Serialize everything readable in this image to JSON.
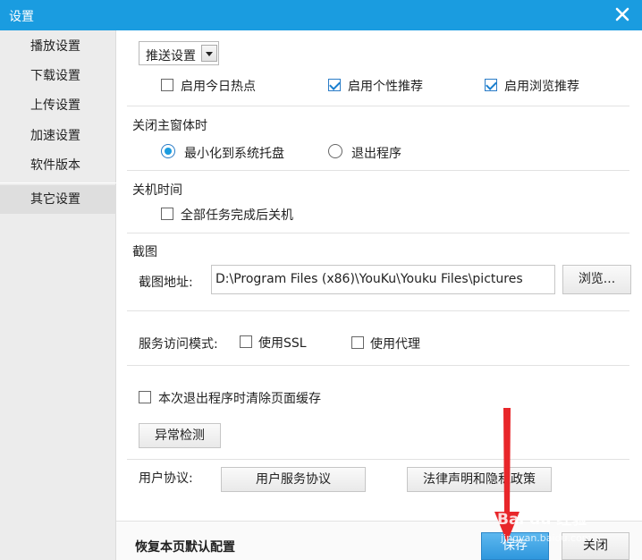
{
  "window": {
    "title": "设置",
    "close_icon": "close-icon"
  },
  "sidebar": {
    "items": [
      {
        "label": "播放设置"
      },
      {
        "label": "下载设置"
      },
      {
        "label": "上传设置"
      },
      {
        "label": "加速设置"
      },
      {
        "label": "软件版本"
      },
      {
        "label": "其它设置",
        "active": true
      }
    ]
  },
  "push": {
    "select_value": "推送设置",
    "options": [
      {
        "label": "启用今日热点",
        "checked": false
      },
      {
        "label": "启用个性推荐",
        "checked": true
      },
      {
        "label": "启用浏览推荐",
        "checked": true
      }
    ]
  },
  "close_main": {
    "title": "关闭主窗体时",
    "options": [
      {
        "label": "最小化到系统托盘",
        "selected": true
      },
      {
        "label": "退出程序",
        "selected": false
      }
    ]
  },
  "shutdown": {
    "title": "关机时间",
    "option": {
      "label": "全部任务完成后关机",
      "checked": false
    }
  },
  "screenshot": {
    "title": "截图",
    "path_label": "截图地址:",
    "path_value": "D:\\Program Files (x86)\\YouKu\\Youku Files\\pictures",
    "browse_label": "浏览..."
  },
  "service": {
    "label": "服务访问模式:",
    "ssl": {
      "label": "使用SSL",
      "checked": false
    },
    "proxy": {
      "label": "使用代理",
      "checked": false
    }
  },
  "cache": {
    "label": "本次退出程序时清除页面缓存",
    "checked": false
  },
  "diagnose": {
    "label": "异常检测"
  },
  "agreement": {
    "label": "用户协议:",
    "service_label": "用户服务协议",
    "legal_label": "法律声明和隐私政策"
  },
  "footer": {
    "restore_label": "恢复本页默认配置",
    "save_label": "保存",
    "close_label": "关闭"
  },
  "colors": {
    "accent": "#1a9ce0",
    "annotation_arrow": "#e8262a"
  },
  "watermark": {
    "line1": "Bai du 经验",
    "line2": "jingyan.baidu.com"
  }
}
